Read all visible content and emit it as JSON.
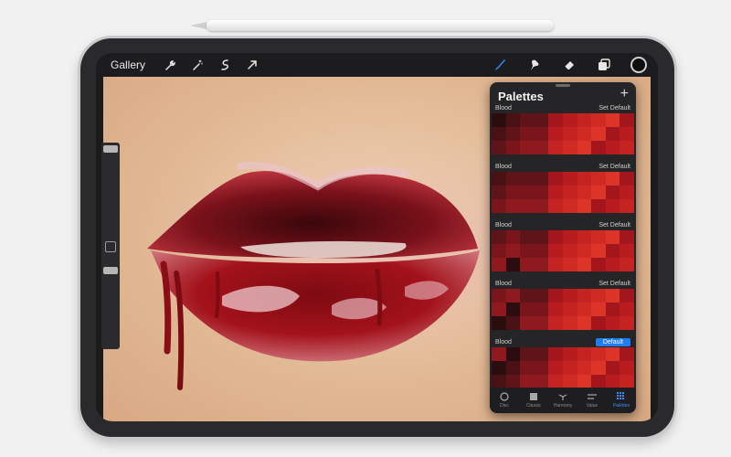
{
  "toolbar": {
    "gallery_label": "Gallery",
    "left_tools": [
      "wrench-icon",
      "magic-wand-icon",
      "selection-icon",
      "transform-arrow-icon"
    ],
    "right_tools": [
      "brush-icon",
      "smudge-icon",
      "eraser-icon",
      "layers-icon"
    ],
    "active_tool": "brush-icon",
    "accent_color": "#3b8cff",
    "current_color": "#0e0e0e"
  },
  "palettes_panel": {
    "title": "Palettes",
    "add_label": "+",
    "palettes": [
      {
        "name": "Blood",
        "default_label": "Set Default",
        "is_default": false
      },
      {
        "name": "Blood",
        "default_label": "Set Default",
        "is_default": false
      },
      {
        "name": "Blood",
        "default_label": "Set Default",
        "is_default": false
      },
      {
        "name": "Blood",
        "default_label": "Set Default",
        "is_default": false
      },
      {
        "name": "Blood",
        "default_label": "Default",
        "is_default": true
      }
    ],
    "tabs": [
      {
        "label": "Disc",
        "icon": "disc-icon"
      },
      {
        "label": "Classic",
        "icon": "classic-icon"
      },
      {
        "label": "Harmony",
        "icon": "harmony-icon"
      },
      {
        "label": "Value",
        "icon": "value-icon"
      },
      {
        "label": "Palettes",
        "icon": "palettes-grid-icon"
      }
    ],
    "active_tab": "Palettes"
  },
  "colors": {
    "swatch_darks": [
      "#2b0d0f",
      "#4a1114",
      "#5e1418",
      "#7a161b",
      "#8e1a1f"
    ],
    "swatch_reds": [
      "#a3161b",
      "#b81c1f",
      "#c52322",
      "#d02a25",
      "#dc3428"
    ]
  }
}
